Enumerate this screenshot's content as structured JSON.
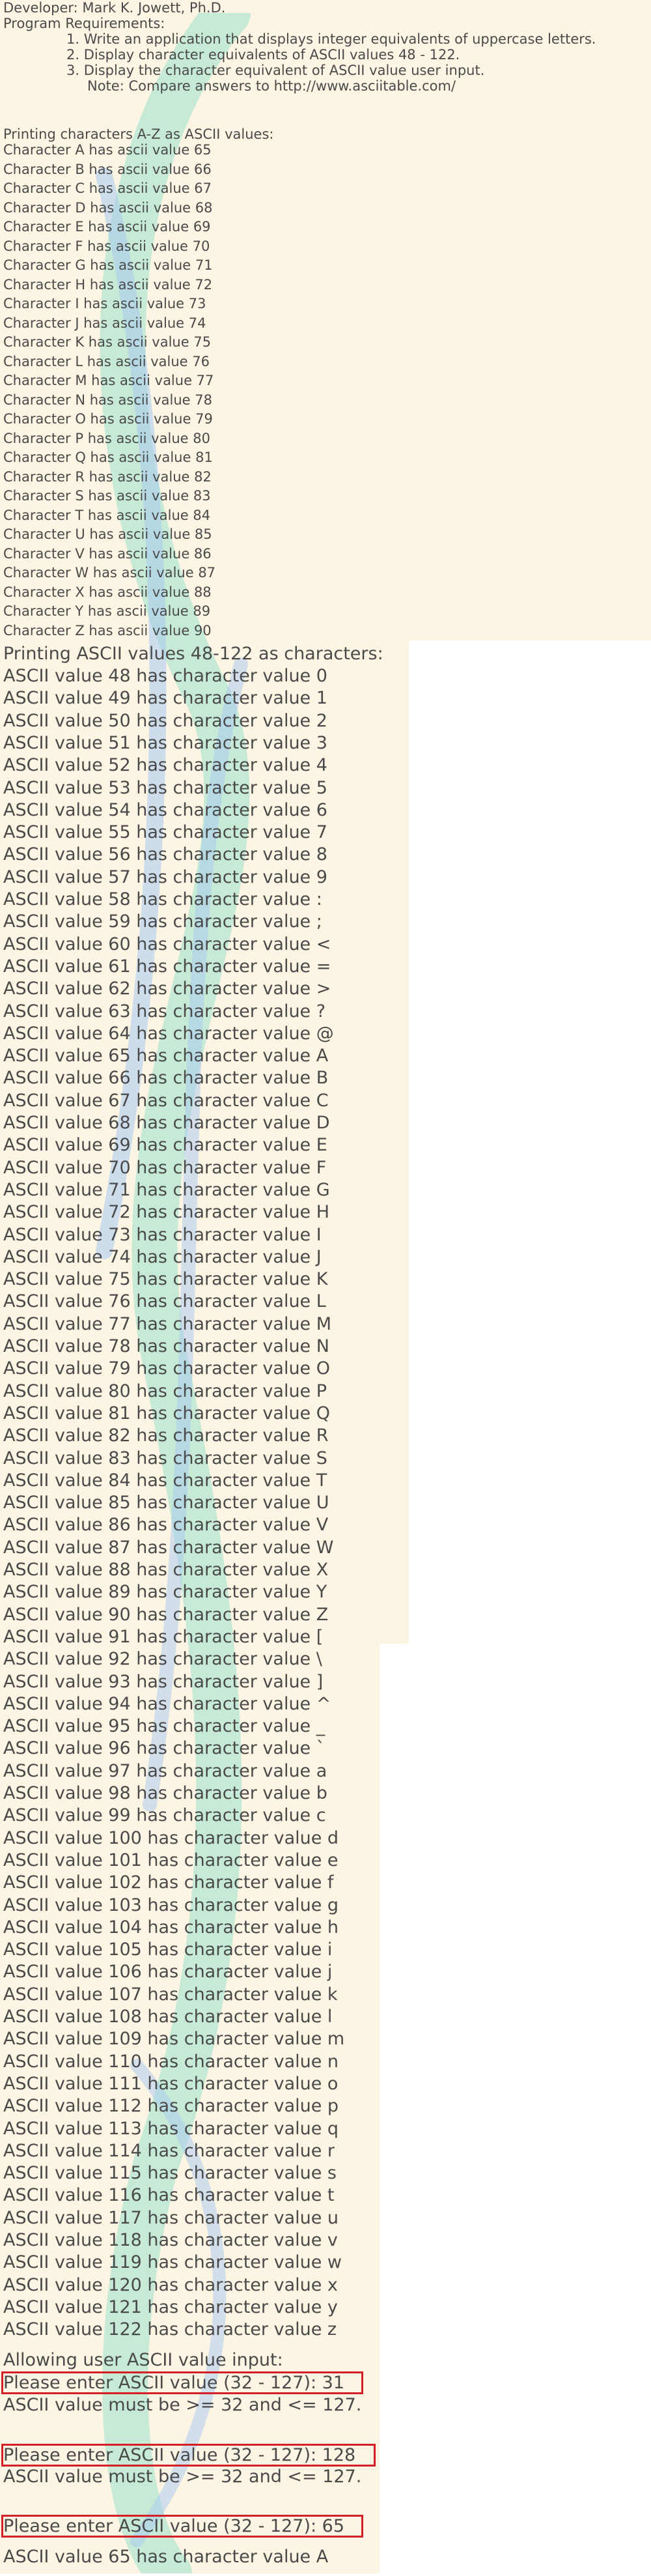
{
  "header": {
    "developer": "Developer: Mark K. Jowett, Ph.D.",
    "requirements_title": "Program Requirements:",
    "requirements": [
      "1. Write an application that displays integer equivalents of uppercase letters.",
      "2. Display character equivalents of ASCII values 48 - 122.",
      "3. Display the character equivalent of ASCII value user input.",
      "Note: Compare answers to http://www.asciitable.com/"
    ]
  },
  "section1": {
    "title": "Printing characters A-Z as ASCII values:",
    "lines": [
      "Character A has ascii value 65",
      "Character B has ascii value 66",
      "Character C has ascii value 67",
      "Character D has ascii value 68",
      "Character E has ascii value 69",
      "Character F has ascii value 70",
      "Character G has ascii value 71",
      "Character H has ascii value 72",
      "Character I has ascii value 73",
      "Character J has ascii value 74",
      "Character K has ascii value 75",
      "Character L has ascii value 76",
      "Character M has ascii value 77",
      "Character N has ascii value 78",
      "Character O has ascii value 79",
      "Character P has ascii value 80",
      "Character Q has ascii value 81",
      "Character R has ascii value 82",
      "Character S has ascii value 83",
      "Character T has ascii value 84",
      "Character U has ascii value 85",
      "Character V has ascii value 86",
      "Character W has ascii value 87",
      "Character X has ascii value 88",
      "Character Y has ascii value 89",
      "Character Z has ascii value 90"
    ]
  },
  "section2": {
    "title": "Printing ASCII values 48-122 as characters:",
    "lines": [
      "ASCII value 48 has character value 0",
      "ASCII value 49 has character value 1",
      "ASCII value 50 has character value 2",
      "ASCII value 51 has character value 3",
      "ASCII value 52 has character value 4",
      "ASCII value 53 has character value 5",
      "ASCII value 54 has character value 6",
      "ASCII value 55 has character value 7",
      "ASCII value 56 has character value 8",
      "ASCII value 57 has character value 9",
      "ASCII value 58 has character value :",
      "ASCII value 59 has character value ;",
      "ASCII value 60 has character value <",
      "ASCII value 61 has character value =",
      "ASCII value 62 has character value >",
      "ASCII value 63 has character value ?",
      "ASCII value 64 has character value @",
      "ASCII value 65 has character value A",
      "ASCII value 66 has character value B",
      "ASCII value 67 has character value C",
      "ASCII value 68 has character value D",
      "ASCII value 69 has character value E",
      "ASCII value 70 has character value F",
      "ASCII value 71 has character value G",
      "ASCII value 72 has character value H",
      "ASCII value 73 has character value I",
      "ASCII value 74 has character value J",
      "ASCII value 75 has character value K",
      "ASCII value 76 has character value L",
      "ASCII value 77 has character value M",
      "ASCII value 78 has character value N",
      "ASCII value 79 has character value O",
      "ASCII value 80 has character value P",
      "ASCII value 81 has character value Q",
      "ASCII value 82 has character value R",
      "ASCII value 83 has character value S",
      "ASCII value 84 has character value T",
      "ASCII value 85 has character value U",
      "ASCII value 86 has character value V",
      "ASCII value 87 has character value W",
      "ASCII value 88 has character value X",
      "ASCII value 89 has character value Y",
      "ASCII value 90 has character value Z",
      "ASCII value 91 has character value [",
      "ASCII value 92 has character value \\",
      "ASCII value 93 has character value ]",
      "ASCII value 94 has character value ^",
      "ASCII value 95 has character value _",
      "ASCII value 96 has character value `",
      "ASCII value 97 has character value a",
      "ASCII value 98 has character value b",
      "ASCII value 99 has character value c",
      "ASCII value 100 has character value d",
      "ASCII value 101 has character value e",
      "ASCII value 102 has character value f",
      "ASCII value 103 has character value g",
      "ASCII value 104 has character value h",
      "ASCII value 105 has character value i",
      "ASCII value 106 has character value j",
      "ASCII value 107 has character value k",
      "ASCII value 108 has character value l",
      "ASCII value 109 has character value m",
      "ASCII value 110 has character value n",
      "ASCII value 111 has character value o",
      "ASCII value 112 has character value p",
      "ASCII value 113 has character value q",
      "ASCII value 114 has character value r",
      "ASCII value 115 has character value s",
      "ASCII value 116 has character value t",
      "ASCII value 117 has character value u",
      "ASCII value 118 has character value v",
      "ASCII value 119 has character value w",
      "ASCII value 120 has character value x",
      "ASCII value 121 has character value y",
      "ASCII value 122 has character value z"
    ]
  },
  "section3": {
    "title": "Allowing user ASCII value input:",
    "entries": [
      {
        "prompt": "Please enter ASCII value (32 - 127): 31",
        "result": "ASCII value must be >= 32 and <= 127."
      },
      {
        "prompt": "Please enter ASCII value (32 - 127): 128",
        "result": "ASCII value must be >= 32 and <= 127."
      },
      {
        "prompt": "Please enter ASCII value (32 - 127): 65",
        "result": "ASCII value 65 has character value A"
      }
    ]
  },
  "colors": {
    "text": "#4a4a4a",
    "panel_bg": "#fdf5e4",
    "highlight_border": "#d41f26"
  },
  "watermark_icon": "teal-lettermark-watermark-icon"
}
